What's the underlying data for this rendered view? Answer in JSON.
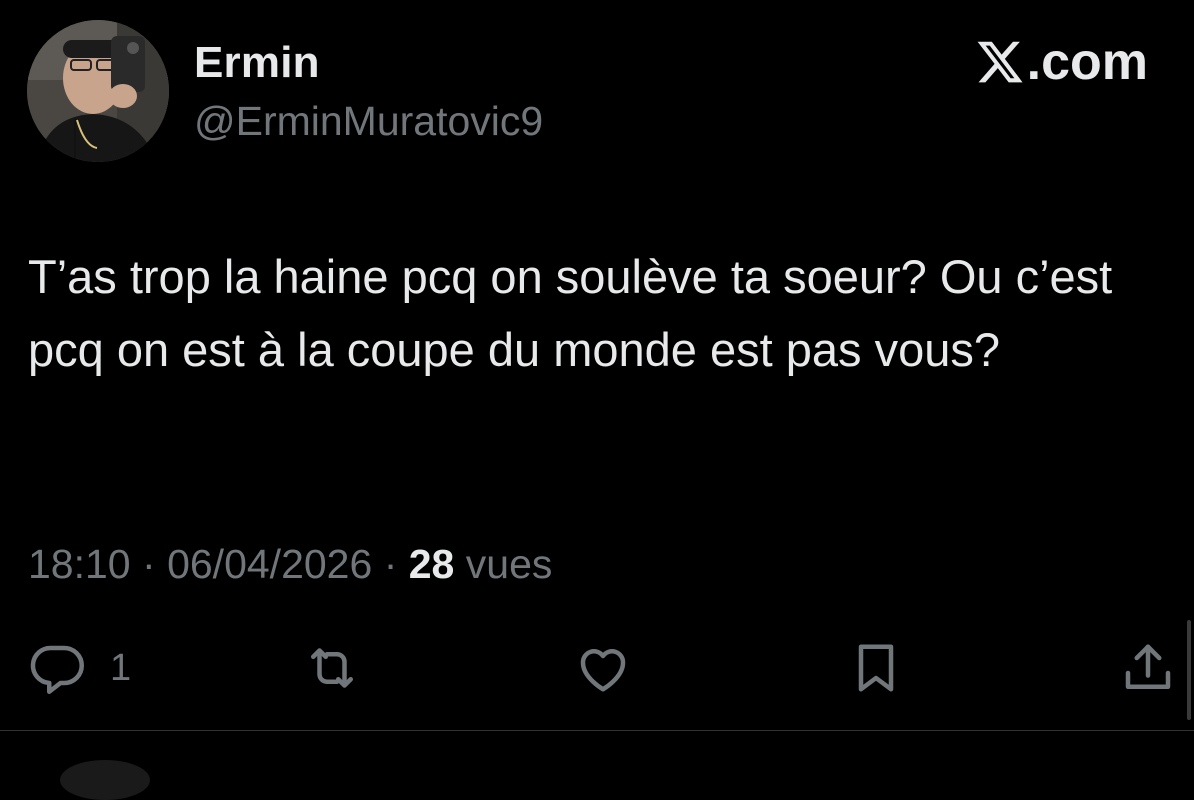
{
  "user": {
    "display_name": "Ermin",
    "handle": "@ErminMuratovic9",
    "avatar_icon": "profile-photo"
  },
  "brand": {
    "logo_icon": "x-logo-icon",
    "suffix": ".com"
  },
  "tweet": {
    "text": "T’as trop la haine pcq on soulève ta soeur? Ou c’est pcq on est à la coupe du monde est pas vous?"
  },
  "meta": {
    "time": "18:10",
    "separator": "·",
    "date": "06/04/2026",
    "views_count": "28",
    "views_label": "vues"
  },
  "actions": {
    "reply_icon": "reply-icon",
    "reply_count": "1",
    "retweet_icon": "retweet-icon",
    "like_icon": "heart-icon",
    "bookmark_icon": "bookmark-icon",
    "share_icon": "share-icon"
  },
  "colors": {
    "background": "#000000",
    "primary_text": "#e7e9ea",
    "secondary_text": "#71767b",
    "divider": "#2f3336"
  }
}
